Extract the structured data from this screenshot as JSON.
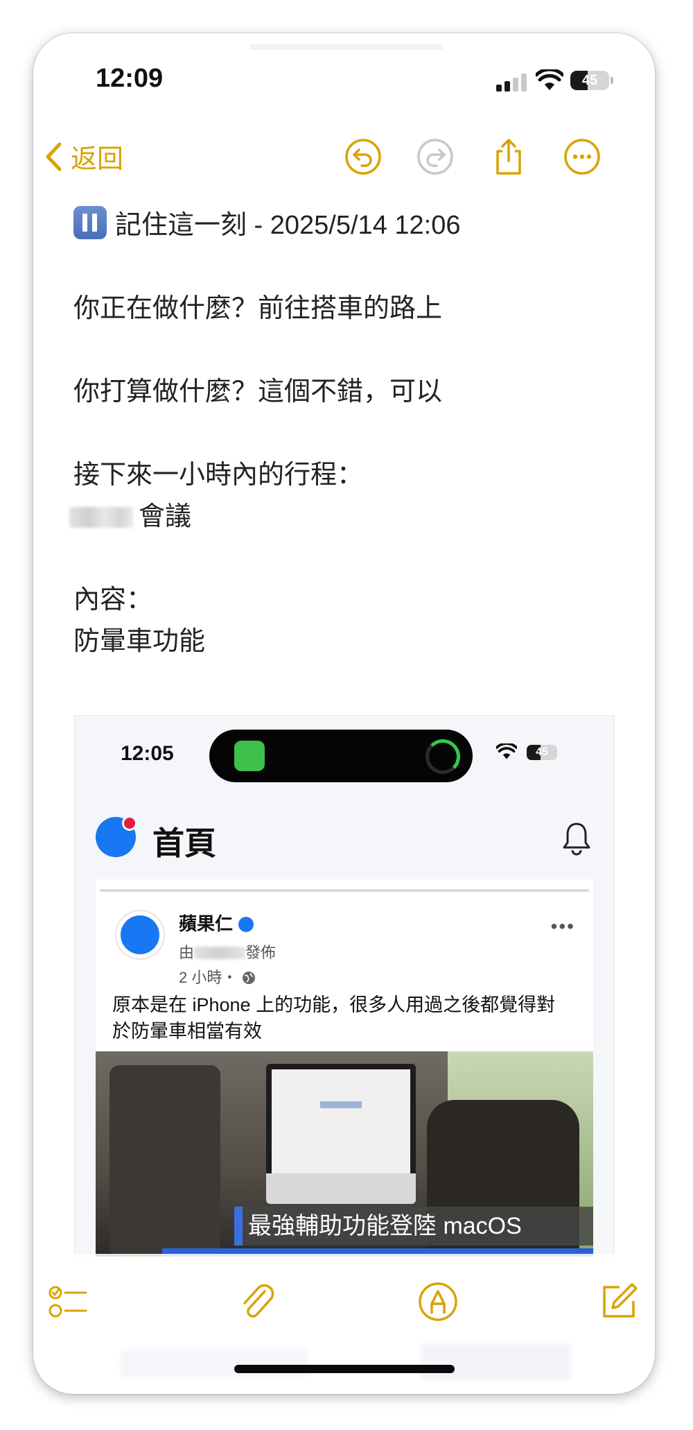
{
  "status_bar": {
    "time": "12:09",
    "battery": "45",
    "battery_level": 0.45
  },
  "toolbar": {
    "back_label": "返回",
    "icons": [
      "undo-icon",
      "redo-icon",
      "share-icon",
      "more-icon"
    ]
  },
  "note": {
    "title": "記住這一刻 - 2025/5/14 12:06",
    "line1": "你正在做什麼？前往搭車的路上",
    "line2": "你打算做什麼？這個不錯，可以",
    "line3": "接下來一小時內的行程：",
    "line4": "會議",
    "line5": "內容：",
    "line6": "防暈車功能"
  },
  "embedded_screenshot": {
    "time": "12:05",
    "battery": "45",
    "battery_level": 0.45,
    "page_title": "首頁",
    "post": {
      "author": "蘋果仁",
      "posted_by_prefix": "由",
      "posted_by_suffix": "發佈",
      "time_ago": "2 小時・",
      "more": "•••",
      "text": "原本是在 iPhone 上的功能，很多人用過之後都覺得對於防暈車相當有效",
      "image_caption": "最強輔助功能登陸 macOS"
    }
  },
  "bottom_toolbar": {
    "icons": [
      "checklist-icon",
      "attachment-icon",
      "markup-icon",
      "compose-icon"
    ]
  },
  "colors": {
    "accent": "#d9a300",
    "facebook_blue": "#1877f2"
  }
}
